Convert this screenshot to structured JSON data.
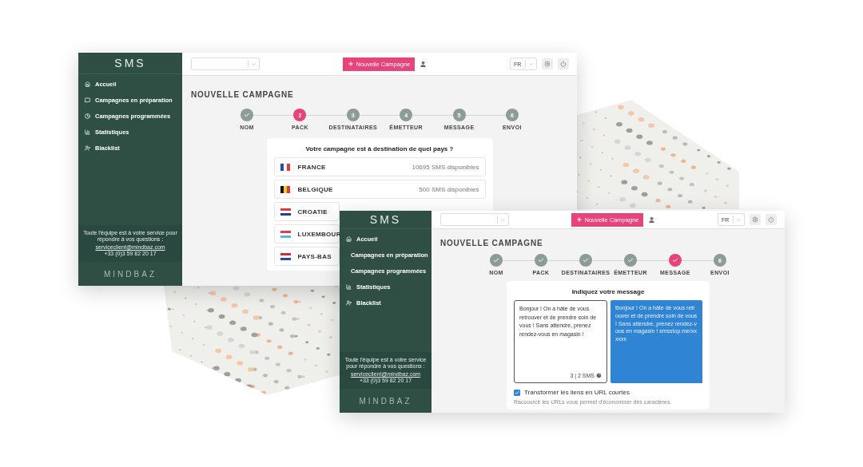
{
  "windows": [
    {
      "kind": "countries",
      "logo": "SMS",
      "nav": [
        {
          "label": "Accueil"
        },
        {
          "label": "Campagnes en préparation"
        },
        {
          "label": "Campagnes programmées"
        },
        {
          "label": "Statistiques"
        },
        {
          "label": "Blacklist"
        }
      ],
      "help": {
        "text": "Toute l'équipe est à votre service pour répondre à vos questions :",
        "email": "serviceclient@mindbaz.com",
        "phone": "+33 (0)3 59 82 20 17"
      },
      "brand": "MINDBAZ",
      "new_button": "Nouvelle Campagne",
      "language": "FR",
      "page_title": "NOUVELLE CAMPAGNE",
      "steps": [
        {
          "label": "NOM",
          "done": true,
          "selected": false
        },
        {
          "label": "PACK",
          "number": "2",
          "done": false,
          "selected": true
        },
        {
          "label": "DESTINATAIRES",
          "number": "3",
          "done": false,
          "selected": false
        },
        {
          "label": "ÉMETTEUR",
          "number": "4",
          "done": false,
          "selected": false
        },
        {
          "label": "MESSAGE",
          "number": "5",
          "done": false,
          "selected": false
        },
        {
          "label": "ENVOI",
          "number": "6",
          "done": false,
          "selected": false
        }
      ],
      "question": "Votre campagne est à destination de quel pays ?",
      "countries": [
        {
          "name": "FRANCE",
          "available": "10695 SMS disponibles"
        },
        {
          "name": "BELGIQUE",
          "available": "500 SMS disponibles"
        },
        {
          "name": "CROATIE"
        },
        {
          "name": "LUXEMBOUR"
        },
        {
          "name": "PAYS-BAS"
        }
      ]
    },
    {
      "kind": "message",
      "logo": "SMS",
      "nav": [
        {
          "label": "Accueil"
        },
        {
          "label": "Campagnes en préparation"
        },
        {
          "label": "Campagnes programmées"
        },
        {
          "label": "Statistiques"
        },
        {
          "label": "Blacklist"
        }
      ],
      "help": {
        "text": "Toute l'équipe est à votre service pour répondre à vos questions :",
        "email": "serviceclient@mindbaz.com",
        "phone": "+33 (0)3 59 82 20 17"
      },
      "brand": "MINDBAZ",
      "new_button": "Nouvelle Campagne",
      "language": "FR",
      "page_title": "NOUVELLE CAMPAGNE",
      "steps": [
        {
          "label": "NOM",
          "done": true,
          "selected": false
        },
        {
          "label": "PACK",
          "done": true,
          "selected": false
        },
        {
          "label": "DESTINATAIRES",
          "done": true,
          "selected": false
        },
        {
          "label": "ÉMETTEUR",
          "done": true,
          "selected": false
        },
        {
          "label": "MESSAGE",
          "done": true,
          "selected": true
        },
        {
          "label": "ENVOI",
          "number": "6",
          "done": false,
          "selected": false
        }
      ],
      "message_title": "Indiquez votre message",
      "message": "Bonjour ! On a hâte de vous retrouver et de prendre soin de vous ! Sans attendre, prenez rendez-vous en magasin !",
      "sms_count": "3 | 2 SMS",
      "preview": "Bonjour ! On a hâte de vous retrouver et de prendre soin de vous ! Sans attendre, prenez rendez-vous en magasin ! smsstop.me/xxxxxx",
      "shorten_links": {
        "label": "Transformer les liens en URL courtes",
        "checked": true
      },
      "hint": "Raccourcir les URLs vous permet d'économiser des caractères."
    }
  ]
}
